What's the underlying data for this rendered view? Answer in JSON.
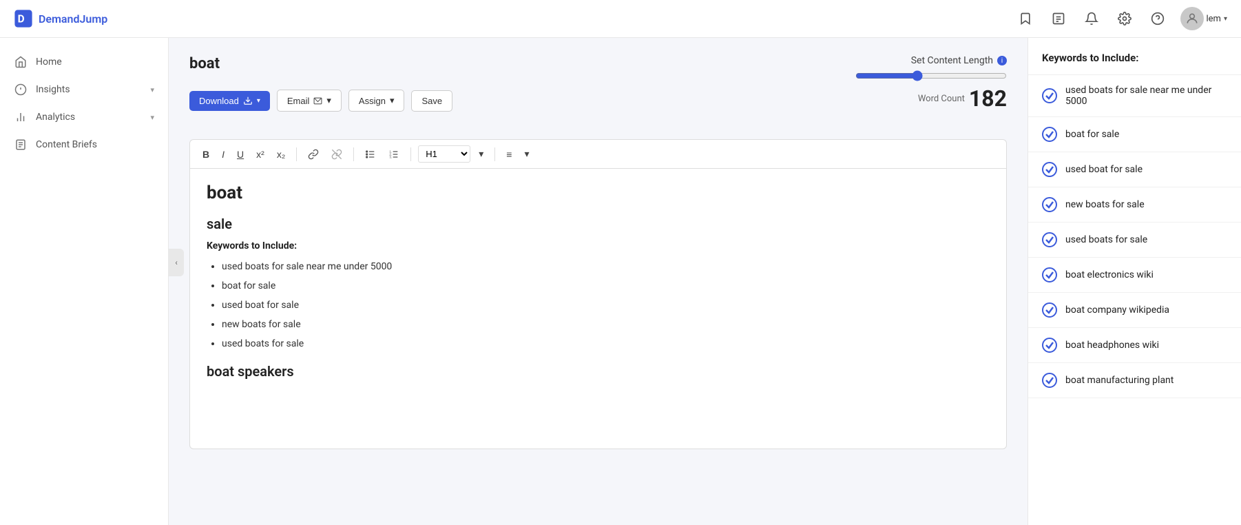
{
  "app": {
    "name": "DemandJump",
    "user_name": "lem"
  },
  "topnav": {
    "icons": [
      {
        "name": "bookmark-icon",
        "symbol": "🔖"
      },
      {
        "name": "document-icon",
        "symbol": "📄"
      },
      {
        "name": "bell-icon",
        "symbol": "🔔"
      },
      {
        "name": "settings-icon",
        "symbol": "⚙"
      },
      {
        "name": "help-icon",
        "symbol": "?"
      }
    ]
  },
  "sidebar": {
    "items": [
      {
        "id": "home",
        "label": "Home",
        "has_arrow": false
      },
      {
        "id": "insights",
        "label": "Insights",
        "has_arrow": true
      },
      {
        "id": "analytics",
        "label": "Analytics",
        "has_arrow": true
      },
      {
        "id": "content-briefs",
        "label": "Content Briefs",
        "has_arrow": false
      }
    ]
  },
  "page": {
    "title": "boat",
    "toolbar": {
      "download_label": "Download",
      "email_label": "Email",
      "assign_label": "Assign",
      "save_label": "Save"
    },
    "content_length": {
      "label": "Set Content Length",
      "slider_value": 40,
      "word_count_label": "Word Count",
      "word_count": "182"
    },
    "editor": {
      "heading1": "boat",
      "heading2": "sale",
      "keywords_section_title": "Keywords to Include:",
      "keywords": [
        "used boats for sale near me under 5000",
        "boat for sale",
        "used boat for sale",
        "new boats for sale",
        "used boats for sale"
      ],
      "heading3": "boat speakers"
    }
  },
  "right_panel": {
    "title": "Keywords to Include:",
    "keywords": [
      {
        "id": 1,
        "text": "used boats for sale near me under 5000",
        "checked": true
      },
      {
        "id": 2,
        "text": "boat for sale",
        "checked": true
      },
      {
        "id": 3,
        "text": "used boat for sale",
        "checked": true
      },
      {
        "id": 4,
        "text": "new boats for sale",
        "checked": true
      },
      {
        "id": 5,
        "text": "used boats for sale",
        "checked": true
      },
      {
        "id": 6,
        "text": "boat electronics wiki",
        "checked": true
      },
      {
        "id": 7,
        "text": "boat company wikipedia",
        "checked": true
      },
      {
        "id": 8,
        "text": "boat headphones wiki",
        "checked": true
      },
      {
        "id": 9,
        "text": "boat manufacturing plant",
        "checked": true
      }
    ]
  },
  "rte_toolbar": {
    "bold": "B",
    "italic": "I",
    "underline": "U",
    "superscript": "x²",
    "subscript": "x₂",
    "heading": "H1",
    "align": "≡"
  }
}
